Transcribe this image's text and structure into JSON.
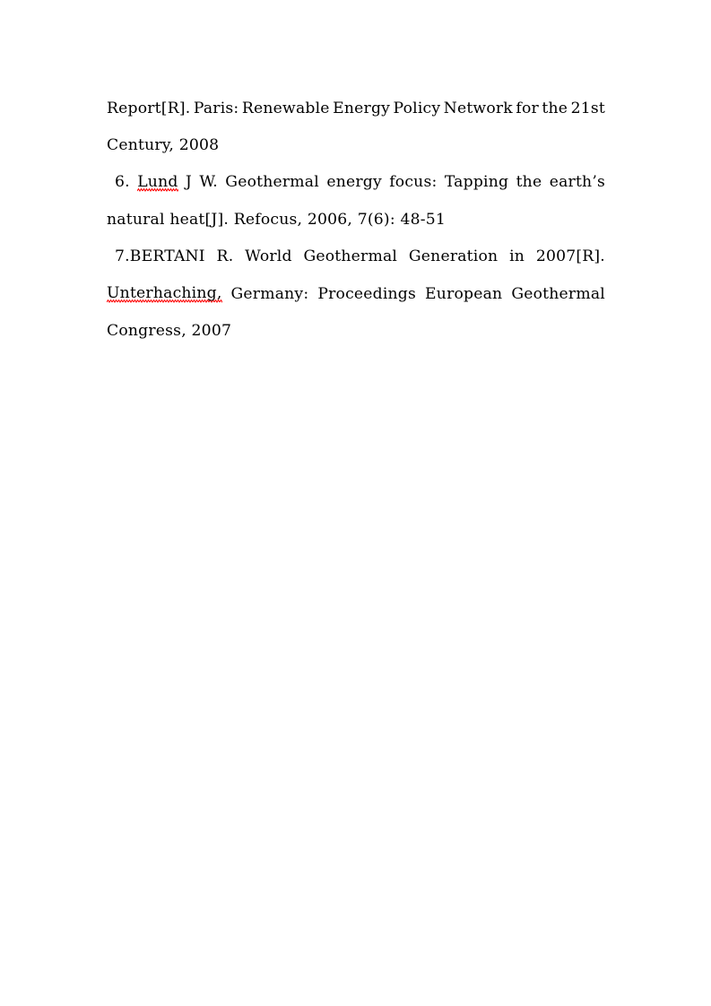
{
  "document": {
    "background_color": "#ffffff",
    "text_color": "#000000",
    "spellcheck_underline_color": "#FF0000",
    "lines": [
      {
        "id": "line-1",
        "align": "justify",
        "indent": false,
        "words": [
          {
            "t": "Report[R]."
          },
          {
            "t": "Paris:"
          },
          {
            "t": "Renewable"
          },
          {
            "t": "Energy"
          },
          {
            "t": "Policy"
          },
          {
            "t": "Network"
          },
          {
            "t": "for"
          },
          {
            "t": "the"
          },
          {
            "t": "21st"
          }
        ]
      },
      {
        "id": "line-2",
        "align": "flush",
        "indent": false,
        "words": [
          {
            "t": "Century,"
          },
          {
            "t": " "
          },
          {
            "t": "2008"
          }
        ]
      },
      {
        "id": "line-3",
        "align": "justify",
        "indent": true,
        "words": [
          {
            "t": "6."
          },
          {
            "t": "Lund",
            "misspelled": true
          },
          {
            "t": "J"
          },
          {
            "t": "W."
          },
          {
            "t": "Geothermal"
          },
          {
            "t": "energy"
          },
          {
            "t": "focus:"
          },
          {
            "t": "Tapping"
          },
          {
            "t": "the"
          },
          {
            "t": "earth’s"
          }
        ]
      },
      {
        "id": "line-4",
        "align": "flush",
        "indent": false,
        "words": [
          {
            "t": "natural"
          },
          {
            "t": " "
          },
          {
            "t": "heat[J]."
          },
          {
            "t": " "
          },
          {
            "t": "Refocus,"
          },
          {
            "t": " "
          },
          {
            "t": "2006,"
          },
          {
            "t": " "
          },
          {
            "t": "7(6):"
          },
          {
            "t": " "
          },
          {
            "t": "48-51"
          }
        ]
      },
      {
        "id": "line-5",
        "align": "justify",
        "indent": true,
        "words": [
          {
            "t": "7.BERTANI"
          },
          {
            "t": "R."
          },
          {
            "t": "World"
          },
          {
            "t": "Geothermal"
          },
          {
            "t": "Generation"
          },
          {
            "t": "in"
          },
          {
            "t": "2007[R]."
          }
        ]
      },
      {
        "id": "line-6",
        "align": "justify",
        "indent": false,
        "words": [
          {
            "t": "Unterhaching,",
            "misspelled": true
          },
          {
            "t": "Germany:"
          },
          {
            "t": "Proceedings"
          },
          {
            "t": "European"
          },
          {
            "t": "Geothermal"
          }
        ]
      },
      {
        "id": "line-7",
        "align": "flush",
        "indent": false,
        "words": [
          {
            "t": "Congress,"
          },
          {
            "t": " "
          },
          {
            "t": "2007"
          }
        ]
      }
    ],
    "references": [
      {
        "number": "6.",
        "text": "Lund J W. Geothermal energy focus: Tapping the earth’s natural heat[J]. Refocus, 2006, 7(6): 48-51"
      },
      {
        "number": "7.",
        "text": "BERTANI R. World Geothermal Generation in 2007[R]. Unterhaching, Germany: Proceedings European Geothermal Congress, 2007"
      }
    ],
    "continued_reference": "Report[R]. Paris: Renewable Energy Policy Network for the 21st Century, 2008"
  }
}
